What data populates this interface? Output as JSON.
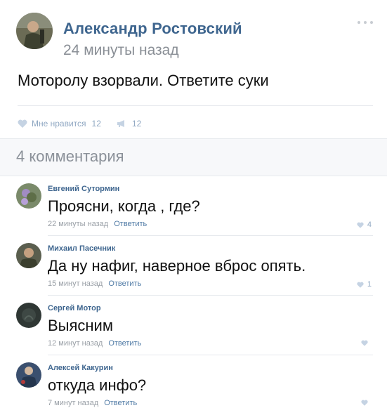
{
  "post": {
    "author": "Александр Ростовский",
    "time": "24 минуты назад",
    "text": "Моторолу взорвали. Ответите суки",
    "like_label": "Мне нравится",
    "like_count": "12",
    "share_count": "12"
  },
  "comments_header": "4 комментария",
  "reply_label": "Ответить",
  "comments": [
    {
      "author": "Евгений Сутормин",
      "text": "Проясни, когда , где?",
      "time": "22 минуты назад",
      "likes": "4"
    },
    {
      "author": "Михаил Пасечник",
      "text": "Да ну нафиг, наверное вброс опять.",
      "time": "15 минут назад",
      "likes": "1"
    },
    {
      "author": "Сергей Мотор",
      "text": "Выясним",
      "time": "12 минут назад",
      "likes": ""
    },
    {
      "author": "Алексей Какурин",
      "text": "откуда инфо?",
      "time": "7 минут назад",
      "likes": ""
    }
  ],
  "colors": {
    "link": "#3f668f",
    "meta": "#9aa0a7",
    "like": "#8fa7c2"
  }
}
